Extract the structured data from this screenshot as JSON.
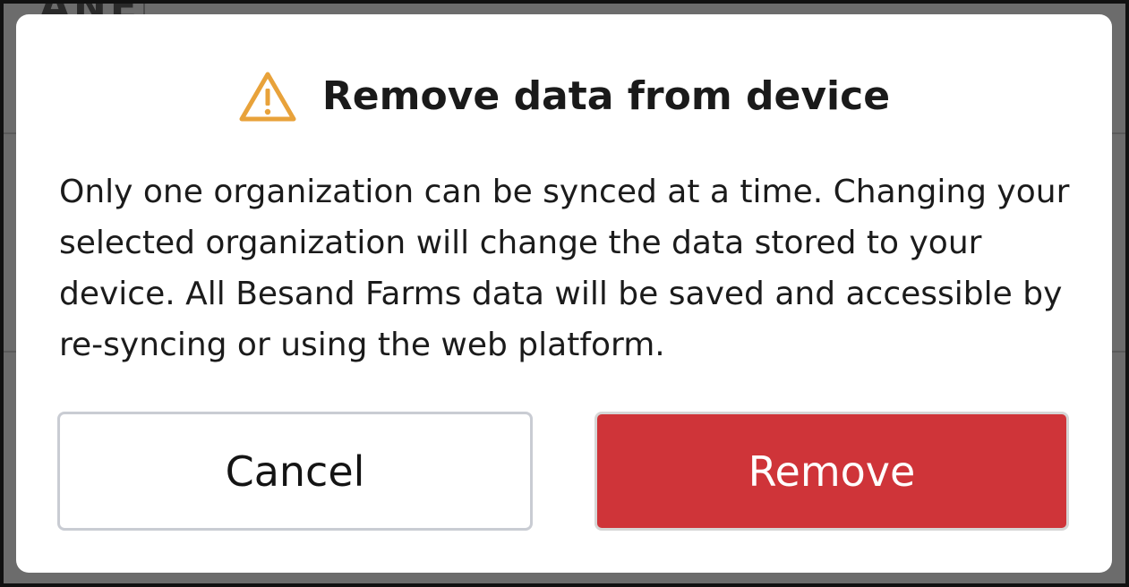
{
  "background": {
    "partial_text": "ANE"
  },
  "dialog": {
    "title": "Remove data from device",
    "icon": "warning-triangle-icon",
    "icon_color": "#e8a23a",
    "message": "Only one organization can be synced at a time. Changing your selected organization will change the data stored to your device. All Besand Farms data will be saved and accessible by re-syncing or using the web platform.",
    "cancel_label": "Cancel",
    "remove_label": "Remove",
    "remove_color": "#cf3439"
  }
}
